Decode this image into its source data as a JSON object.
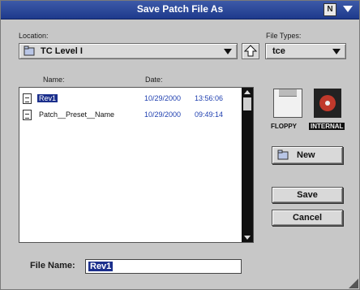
{
  "window": {
    "title": "Save Patch File As"
  },
  "titlebar": {
    "n_button": "N"
  },
  "location": {
    "label": "Location:",
    "value": "TC Level I"
  },
  "filetypes": {
    "label": "File Types:",
    "value": "tce"
  },
  "columns": {
    "name": "Name:",
    "date": "Date:"
  },
  "files": [
    {
      "name": "Rev1",
      "date": "10/29/2000",
      "time": "13:56:06",
      "selected": true
    },
    {
      "name": "Patch__Preset__Name",
      "date": "10/29/2000",
      "time": "09:49:14",
      "selected": false
    }
  ],
  "volumes": {
    "floppy": "FLOPPY",
    "internal": "INTERNAL"
  },
  "buttons": {
    "new": "New",
    "save": "Save",
    "cancel": "Cancel"
  },
  "filename": {
    "label": "File Name:",
    "value": "Rev1"
  }
}
